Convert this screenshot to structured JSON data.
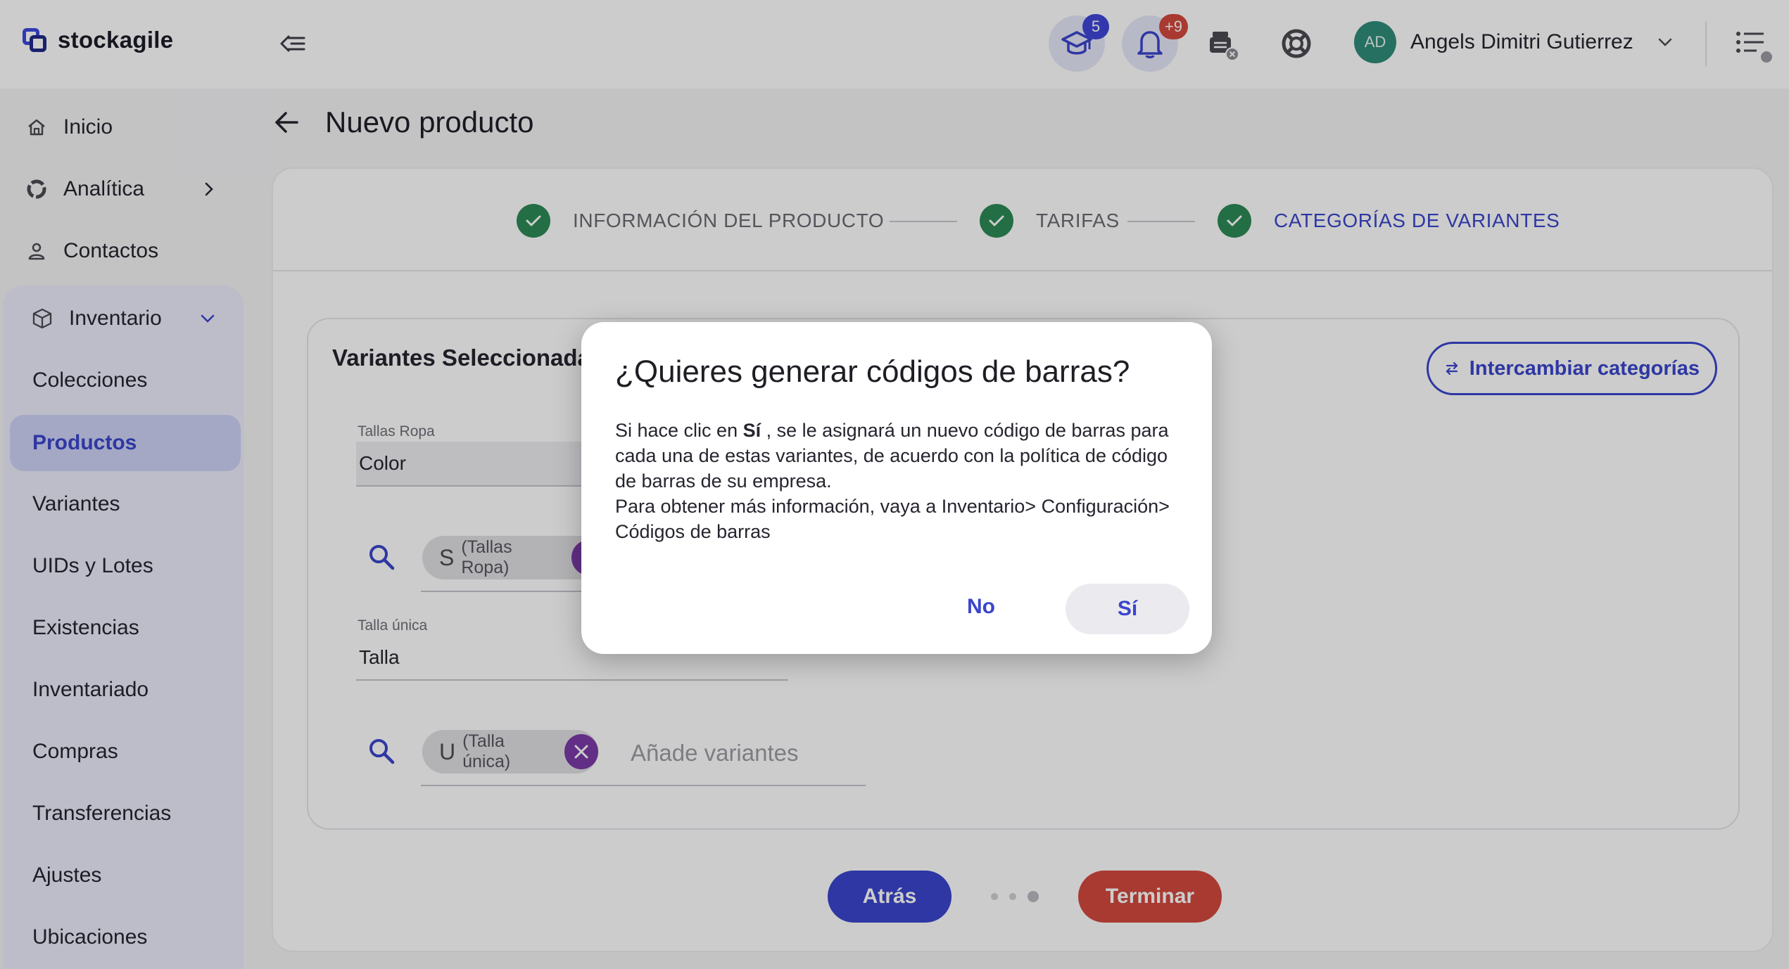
{
  "brand": {
    "name": "stockagile"
  },
  "topbar": {
    "training_badge": "5",
    "notifications_badge": "+9",
    "user_initials": "AD",
    "user_name": "Angels Dimitri Gutierrez"
  },
  "sidebar": {
    "items": [
      {
        "label": "Inicio",
        "icon": "home-icon"
      },
      {
        "label": "Analítica",
        "icon": "analytics-icon"
      },
      {
        "label": "Contactos",
        "icon": "person-icon"
      }
    ],
    "inventory": {
      "label": "Inventario",
      "icon": "box-icon",
      "sub_items": [
        "Colecciones",
        "Productos",
        "Variantes",
        "UIDs y Lotes",
        "Existencias",
        "Inventariado",
        "Compras",
        "Transferencias",
        "Ajustes",
        "Ubicaciones"
      ],
      "active": "Productos"
    }
  },
  "page": {
    "title": "Nuevo producto"
  },
  "stepper": {
    "steps": [
      "INFORMACIÓN DEL PRODUCTO",
      "TARIFAS",
      "CATEGORÍAS DE VARIANTES"
    ],
    "active_index": 2
  },
  "variants": {
    "title": "Variantes Seleccionadas",
    "swap_button": "Intercambiar categorías",
    "groups": [
      {
        "label": "Tallas Ropa",
        "value": "Color",
        "chip_main": "S",
        "chip_sub": "(Tallas Ropa)"
      },
      {
        "label": "Talla única",
        "value": "Talla",
        "chip_main": "U",
        "chip_sub": "(Talla única)",
        "placeholder": "Añade variantes"
      }
    ]
  },
  "footer": {
    "back": "Atrás",
    "finish": "Terminar"
  },
  "modal": {
    "title": "¿Quieres generar códigos de barras?",
    "body_prefix": "Si hace clic en ",
    "body_bold": "Sí",
    "body_suffix": " , se le asignará un nuevo código de barras para cada una de estas variantes, de acuerdo con la política de código de barras de su empresa.",
    "body_line2": "Para obtener más información, vaya a Inventario> Configuración> Códigos de barras",
    "no_label": "No",
    "yes_label": "Sí"
  },
  "colors": {
    "accent": "#3a45cc",
    "success": "#2e8a57",
    "danger": "#d2493e",
    "chip_x": "#7b3aa8"
  }
}
